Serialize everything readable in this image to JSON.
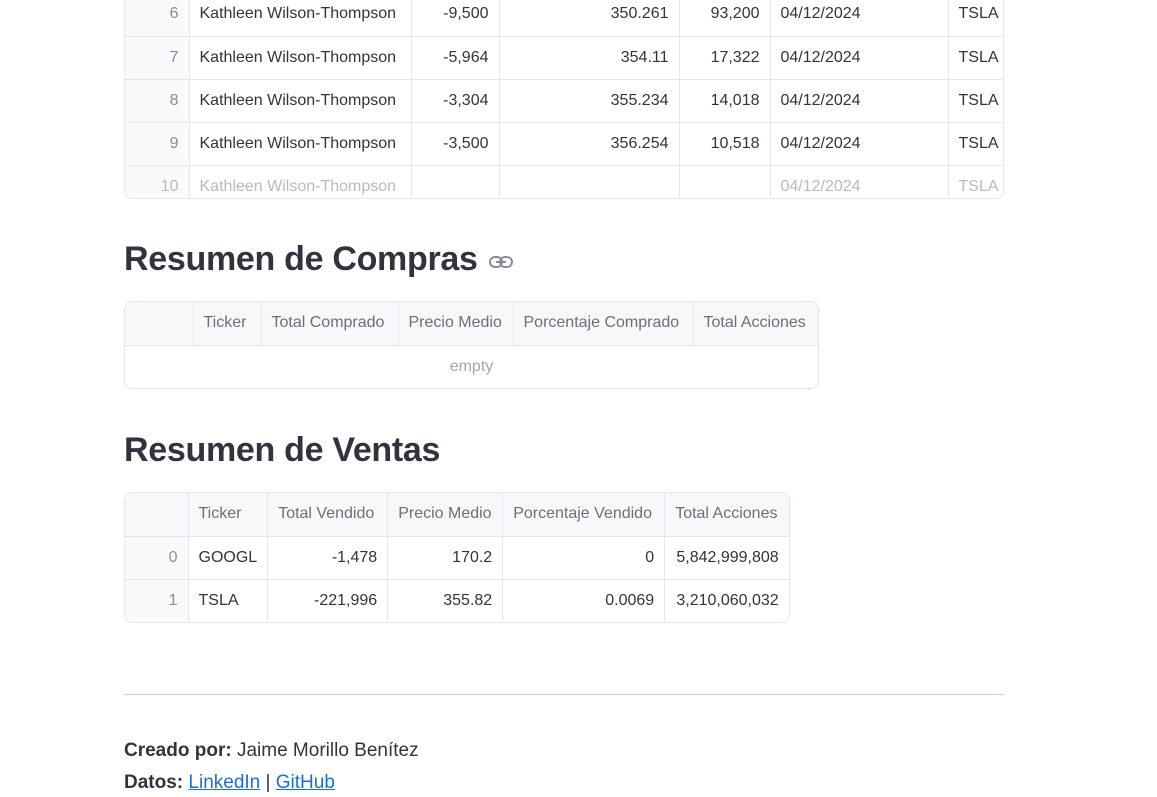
{
  "transactions_table": {
    "rows": [
      {
        "index": "6",
        "name": "Kathleen Wilson-Thompson",
        "shares": "-9,500",
        "price": "350.261",
        "remaining": "93,200",
        "date": "04/12/2024",
        "ticker": "TSLA"
      },
      {
        "index": "7",
        "name": "Kathleen Wilson-Thompson",
        "shares": "-5,964",
        "price": "354.11",
        "remaining": "17,322",
        "date": "04/12/2024",
        "ticker": "TSLA"
      },
      {
        "index": "8",
        "name": "Kathleen Wilson-Thompson",
        "shares": "-3,304",
        "price": "355.234",
        "remaining": "14,018",
        "date": "04/12/2024",
        "ticker": "TSLA"
      },
      {
        "index": "9",
        "name": "Kathleen Wilson-Thompson",
        "shares": "-3,500",
        "price": "356.254",
        "remaining": "10,518",
        "date": "04/12/2024",
        "ticker": "TSLA"
      },
      {
        "index": "10",
        "name": "Kathleen Wilson-Thompson",
        "shares": "",
        "price": "",
        "remaining": "",
        "date": "04/12/2024",
        "ticker": "TSLA"
      }
    ]
  },
  "compras": {
    "title": "Resumen de Compras",
    "anchor_icon": "link-icon",
    "headers": [
      "",
      "Ticker",
      "Total Comprado",
      "Precio Medio",
      "Porcentaje Comprado",
      "Total Acciones"
    ],
    "empty_text": "empty"
  },
  "ventas": {
    "title": "Resumen de Ventas",
    "headers": [
      "",
      "Ticker",
      "Total Vendido",
      "Precio Medio",
      "Porcentaje Vendido",
      "Total Acciones"
    ],
    "rows": [
      {
        "index": "0",
        "ticker": "GOOGL",
        "total": "-1,478",
        "precio": "170.2",
        "porcentaje": "0",
        "acciones": "5,842,999,808"
      },
      {
        "index": "1",
        "ticker": "TSLA",
        "total": "-221,996",
        "precio": "355.82",
        "porcentaje": "0.0069",
        "acciones": "3,210,060,032"
      }
    ]
  },
  "footer": {
    "created_label": "Creado por:",
    "created_value": "Jaime Morillo Benítez",
    "data_label": "Datos:",
    "linkedin": "LinkedIn",
    "separator": "|",
    "github": "GitHub"
  },
  "colors": {
    "link": "#1a6fd4",
    "text": "#31333f",
    "border": "#e6e7eb"
  }
}
